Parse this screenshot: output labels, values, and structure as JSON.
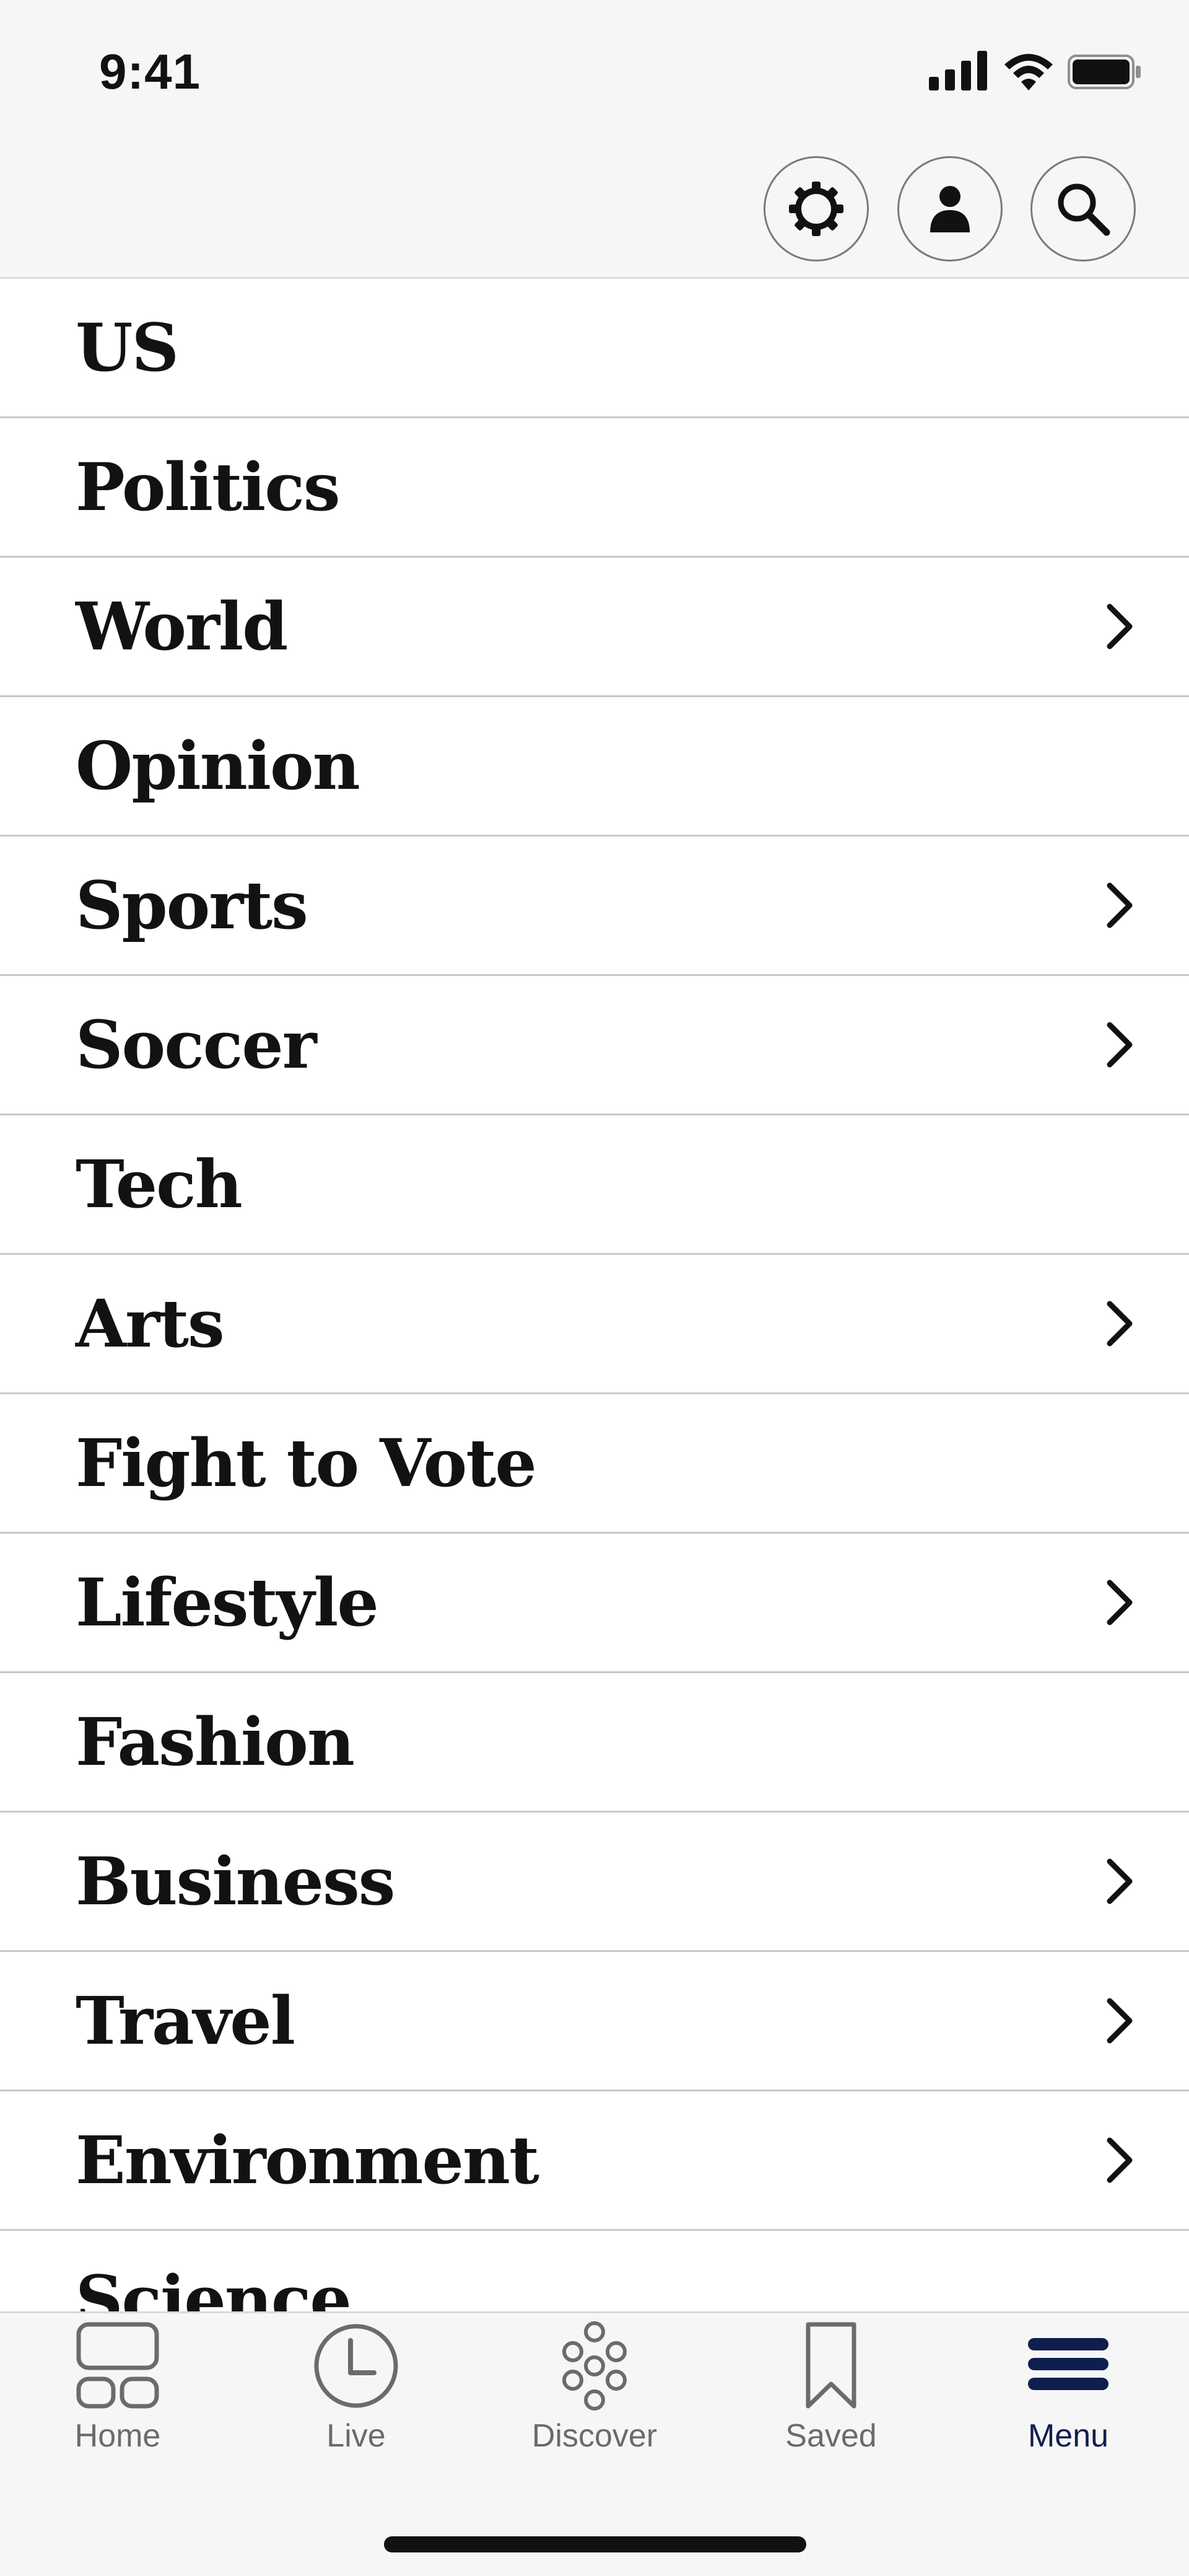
{
  "status_bar": {
    "time": "9:41"
  },
  "top_actions": [
    {
      "name": "settings",
      "icon": "gear-icon"
    },
    {
      "name": "account",
      "icon": "person-icon"
    },
    {
      "name": "search",
      "icon": "search-icon"
    }
  ],
  "menu": {
    "items": [
      {
        "label": "US",
        "has_submenu": false
      },
      {
        "label": "Politics",
        "has_submenu": false
      },
      {
        "label": "World",
        "has_submenu": true
      },
      {
        "label": "Opinion",
        "has_submenu": false
      },
      {
        "label": "Sports",
        "has_submenu": true
      },
      {
        "label": "Soccer",
        "has_submenu": true
      },
      {
        "label": "Tech",
        "has_submenu": false
      },
      {
        "label": "Arts",
        "has_submenu": true
      },
      {
        "label": "Fight to Vote",
        "has_submenu": false
      },
      {
        "label": "Lifestyle",
        "has_submenu": true
      },
      {
        "label": "Fashion",
        "has_submenu": false
      },
      {
        "label": "Business",
        "has_submenu": true
      },
      {
        "label": "Travel",
        "has_submenu": true
      },
      {
        "label": "Environment",
        "has_submenu": true
      },
      {
        "label": "Science",
        "has_submenu": false
      }
    ]
  },
  "tab_bar": {
    "tabs": [
      {
        "label": "Home",
        "icon": "home-grid-icon",
        "active": false
      },
      {
        "label": "Live",
        "icon": "clock-icon",
        "active": false
      },
      {
        "label": "Discover",
        "icon": "discover-dots-icon",
        "active": false
      },
      {
        "label": "Saved",
        "icon": "bookmark-icon",
        "active": false
      },
      {
        "label": "Menu",
        "icon": "menu-icon",
        "active": true
      }
    ]
  },
  "colors": {
    "accent": "#0f1f4d",
    "text": "#121212",
    "muted": "#6b6b6b",
    "bar_bg": "#f6f6f6"
  }
}
